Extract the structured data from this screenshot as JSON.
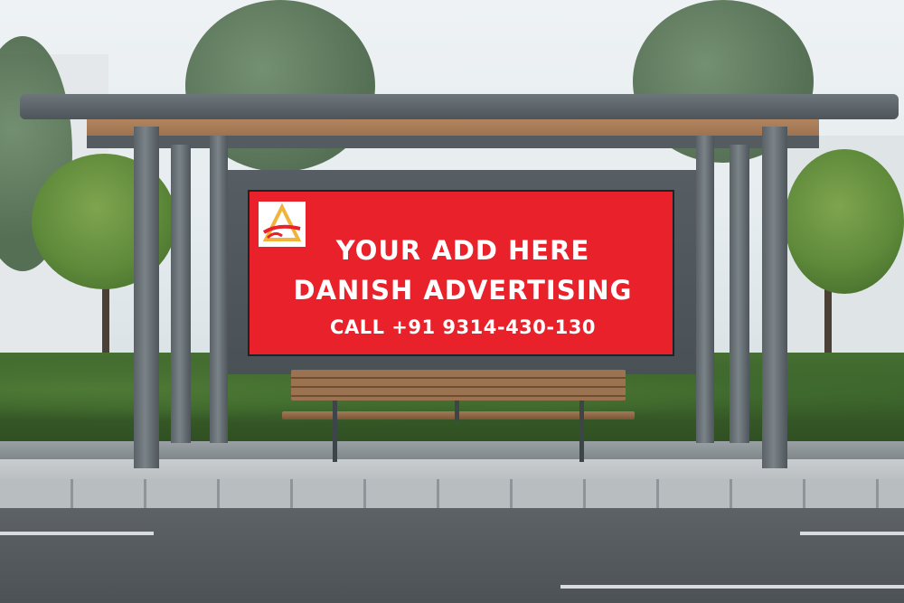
{
  "billboard": {
    "line1": "YOUR ADD HERE",
    "line2": "DANISH ADVERTISING",
    "line3": "CALL +91 9314-430-130",
    "background_color": "#e8212b",
    "text_color": "#ffffff"
  },
  "logo": {
    "icon": "triangle-swoosh-logo-icon",
    "colors": [
      "#e8212b",
      "#f0b43c"
    ]
  }
}
